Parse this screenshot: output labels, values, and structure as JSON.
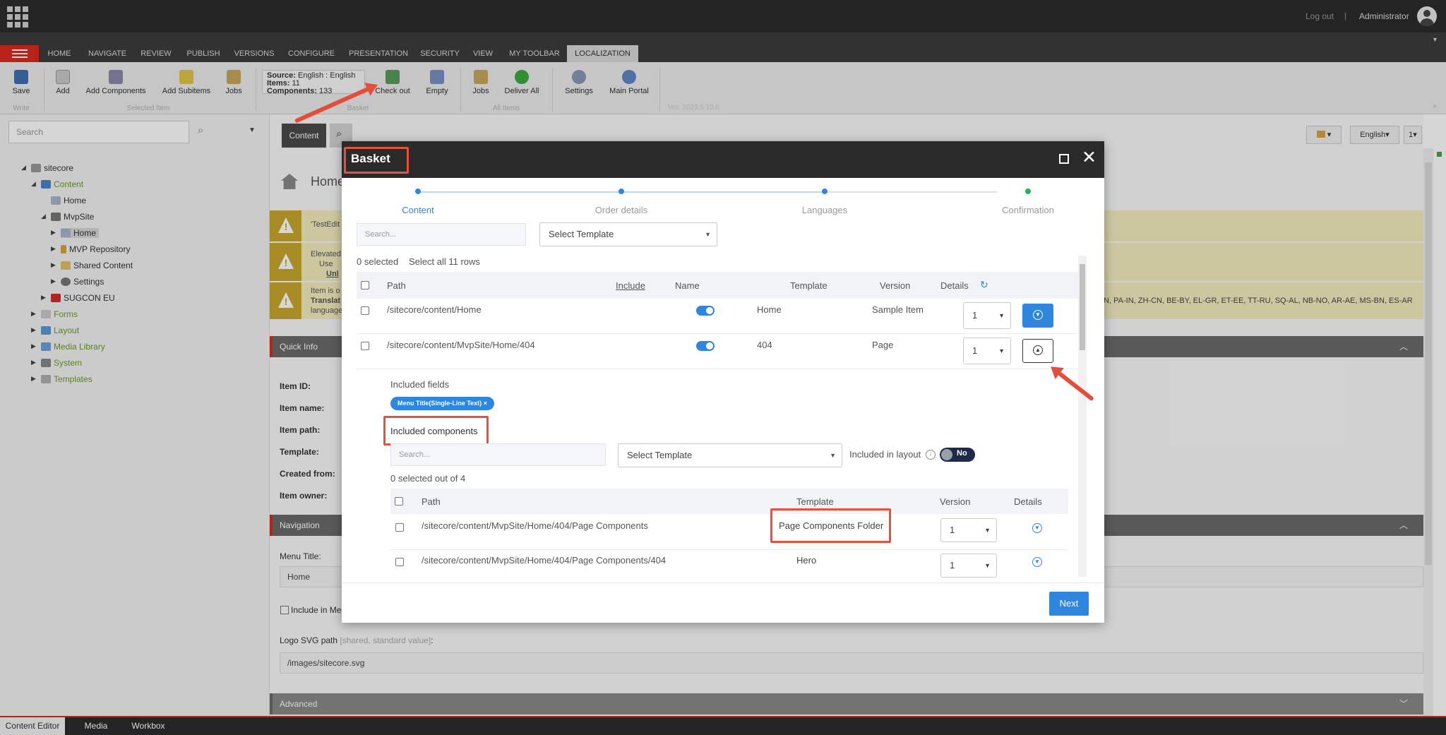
{
  "topbar": {
    "logout": "Log out",
    "separator": "|",
    "user": "Administrator"
  },
  "ribbon_tabs": [
    "HOME",
    "NAVIGATE",
    "REVIEW",
    "PUBLISH",
    "VERSIONS",
    "CONFIGURE",
    "PRESENTATION",
    "SECURITY",
    "VIEW",
    "MY TOOLBAR",
    "LOCALIZATION"
  ],
  "ribbon": {
    "save": "Save",
    "write_group": "Write",
    "add": "Add",
    "add_components": "Add Components",
    "add_subitems": "Add Subitems",
    "jobs": "Jobs",
    "selected_group": "Selected Item",
    "source_label": "Source:",
    "source_value": "English : English",
    "items_label": "Items:",
    "items_value": "11",
    "components_label": "Components:",
    "components_value": "133",
    "checkout": "Check out",
    "empty": "Empty",
    "basket_group": "Basket",
    "jobs2": "Jobs",
    "deliver_all": "Deliver All",
    "all_group": "All Items",
    "settings": "Settings",
    "main_portal": "Main Portal",
    "version": "Ver. 2023.5.10.0"
  },
  "left": {
    "search_placeholder": "Search",
    "tree": [
      "sitecore",
      "Content",
      "Home",
      "MvpSite",
      "Home",
      "MVP Repository",
      "Shared Content",
      "Settings",
      "SUGCON EU",
      "Forms",
      "Layout",
      "Media Library",
      "System",
      "Templates"
    ]
  },
  "content": {
    "tab": "Content",
    "page_title": "Home",
    "warn1": "'TestEdit",
    "warn2a": "Elevated",
    "warn2b": "Use",
    "warn2c": "Unl",
    "warn3a": "Item is o",
    "warn3b": "Translat",
    "warn3c": "language",
    "warn3_right": "IN, PA-IN, ZH-CN, BE-BY, EL-GR, ET-EE, TT-RU, SQ-AL, NB-NO, AR-AE, MS-BN, ES-AR",
    "quick_info": "Quick Info",
    "item_id": "Item ID:",
    "item_name": "Item name:",
    "item_path": "Item path:",
    "template": "Template:",
    "created_from": "Created from:",
    "item_owner": "Item owner:",
    "navigation": "Navigation",
    "menu_title_label": "Menu Title:",
    "menu_title_value": "Home",
    "include_in_menu": "Include in Men",
    "logo_label": "Logo SVG path",
    "logo_meta": "[shared, standard value]",
    "logo_colon": ":",
    "logo_value": "/images/sitecore.svg",
    "advanced": "Advanced",
    "lang_btn": "English",
    "ver_btn": "1"
  },
  "bottom_tabs": [
    "Content Editor",
    "Media Library",
    "Workbox"
  ],
  "dialog": {
    "title": "Basket",
    "steps": [
      "Content",
      "Order details",
      "Languages",
      "Confirmation"
    ],
    "search_placeholder": "Search...",
    "template_select": "Select Template",
    "selected": "0 selected",
    "select_all": "Select all 11 rows",
    "cols": {
      "path": "Path",
      "include": "Include",
      "name": "Name",
      "template": "Template",
      "version": "Version",
      "details": "Details"
    },
    "rows": [
      {
        "path": "/sitecore/content/Home",
        "name": "Home",
        "template": "Sample Item",
        "version": "1"
      },
      {
        "path": "/sitecore/content/MvpSite/Home/404",
        "name": "404",
        "template": "Page",
        "version": "1"
      }
    ],
    "included_fields": "Included fields",
    "chip": "Menu Title(Single-Line Text)",
    "chip_x": "×",
    "included_components": "Included components",
    "comp_search_placeholder": "Search...",
    "comp_template_select": "Select Template",
    "included_in_layout": "Included in layout",
    "no": "No",
    "comp_selected": "0 selected out of 4",
    "comp_cols": {
      "path": "Path",
      "template": "Template",
      "version": "Version",
      "details": "Details"
    },
    "comp_rows": [
      {
        "path": "/sitecore/content/MvpSite/Home/404/Page Components",
        "template": "Page Components Folder",
        "version": "1"
      },
      {
        "path": "/sitecore/content/MvpSite/Home/404/Page Components/404",
        "template": "Hero",
        "version": "1"
      }
    ],
    "next": "Next"
  },
  "colors": {
    "accent": "#2e86de",
    "brand_red": "#dc291e",
    "annotation": "#e24e3b"
  }
}
